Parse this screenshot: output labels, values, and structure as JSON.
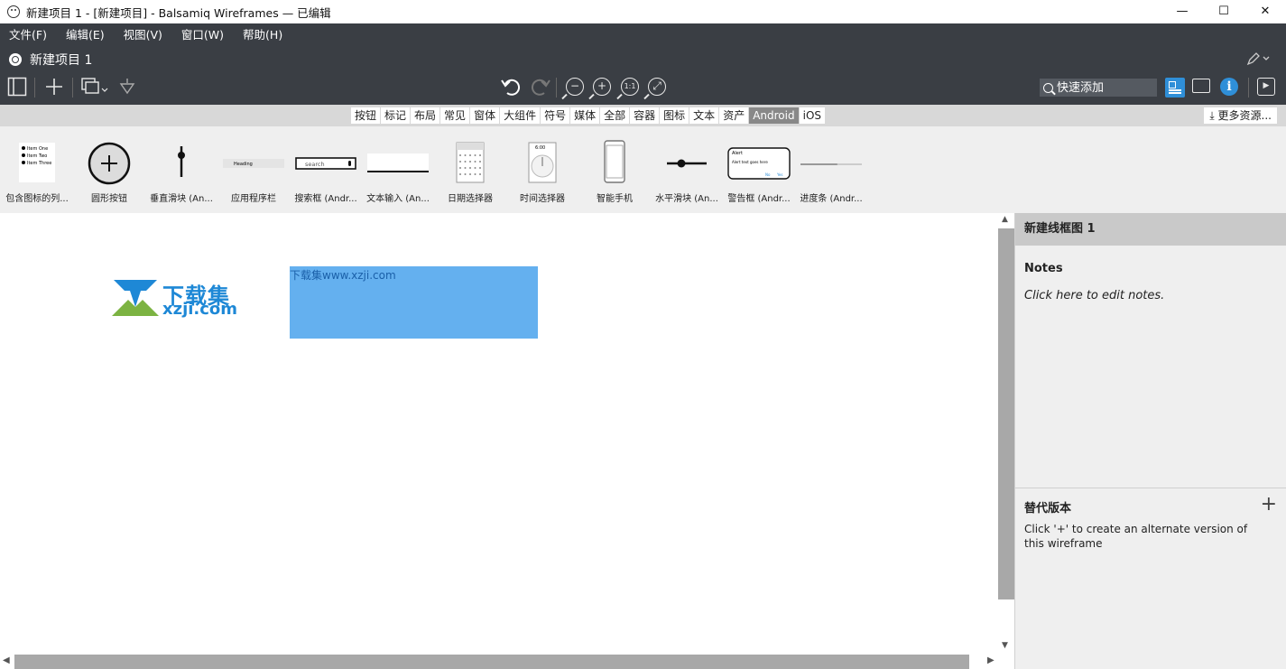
{
  "window": {
    "title": "新建项目 1 - [新建项目] - Balsamiq Wireframes — 已编辑",
    "minimize": "—",
    "maximize": "☐",
    "close": "✕"
  },
  "menu": [
    "文件(F)",
    "编辑(E)",
    "视图(V)",
    "窗口(W)",
    "帮助(H)"
  ],
  "project": {
    "title": "新建项目 1"
  },
  "toolbar": {
    "quick_add_placeholder": "快速添加",
    "undo_icon": "↶",
    "redo_icon": "↷",
    "zoom_out": "−",
    "zoom_in": "+",
    "zoom_actual": "1:1",
    "zoom_fit": "⤢"
  },
  "categories": [
    "按钮",
    "标记",
    "布局",
    "常见",
    "窗体",
    "大组件",
    "符号",
    "媒体",
    "全部",
    "容器",
    "图标",
    "文本",
    "资产",
    "Android",
    "iOS"
  ],
  "active_category": "Android",
  "more_resources": "更多资源...",
  "library": [
    {
      "label": "包含图标的列...",
      "kind": "list",
      "items": [
        "Item One",
        "Item Two",
        "Item Three"
      ]
    },
    {
      "label": "圆形按钮",
      "kind": "fab"
    },
    {
      "label": "垂直滑块 (An...",
      "kind": "vslider"
    },
    {
      "label": "应用程序栏",
      "kind": "appbar",
      "text": "Heading"
    },
    {
      "label": "搜索框 (Andr...",
      "kind": "search",
      "text": "search"
    },
    {
      "label": "文本输入 (An...",
      "kind": "textinput"
    },
    {
      "label": "日期选择器",
      "kind": "datepicker"
    },
    {
      "label": "时间选择器",
      "kind": "timepicker",
      "text": "6:00"
    },
    {
      "label": "智能手机",
      "kind": "phone"
    },
    {
      "label": "水平滑块 (An...",
      "kind": "hslider"
    },
    {
      "label": "警告框 (Andr...",
      "kind": "alert",
      "title": "Alert",
      "body": "Alert text goes here",
      "btn1": "No",
      "btn2": "Yes"
    },
    {
      "label": "进度条 (Andr...",
      "kind": "progress",
      "progress": 0.6
    }
  ],
  "canvas": {
    "logo_cn": "下载集",
    "logo_en": "xzji.com",
    "selected_text": "下载集www.xzji.com"
  },
  "right_panel": {
    "wireframe_name": "新建线框图 1",
    "notes_title": "Notes",
    "notes_body": "Click here to edit notes.",
    "alt_title": "替代版本",
    "alt_add": "+",
    "alt_body": "Click '+' to create an alternate version of this wireframe"
  },
  "colors": {
    "header_bg": "#3a3e44",
    "accent": "#2f8fd8",
    "selection": "#64b0ef"
  }
}
